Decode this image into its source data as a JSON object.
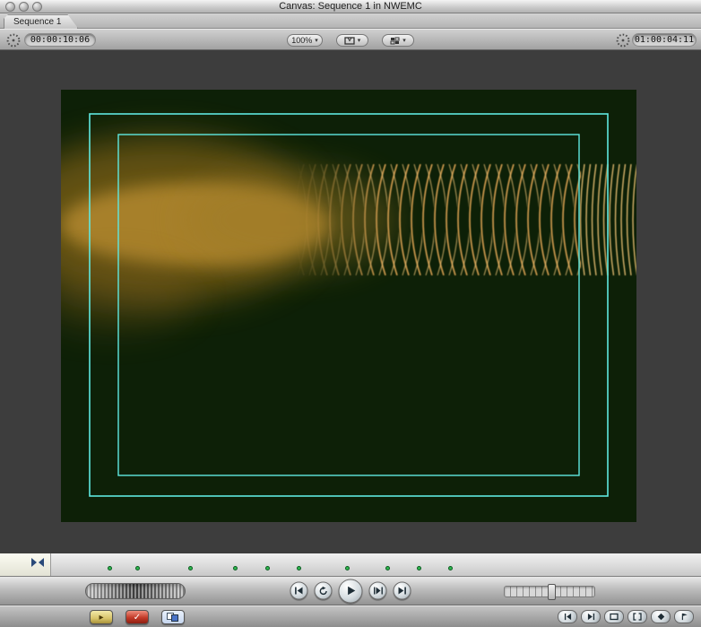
{
  "window": {
    "title": "Canvas: Sequence 1 in NWEMC"
  },
  "tabs": [
    {
      "label": "Sequence 1"
    }
  ],
  "toolbar": {
    "current_timecode": "00:00:10:06",
    "zoom_value": "100%",
    "timeline_timecode": "01:00:04:11",
    "caret_glyph": "▾",
    "icons": [
      "clock-icon",
      "view-popup-icon",
      "layout-popup-icon",
      "clock-icon"
    ]
  },
  "scrubber": {
    "playhead_position_pct": 4.7,
    "marker_positions_pct": [
      15.3,
      19.3,
      26.8,
      33.3,
      37.8,
      42.3,
      49.2,
      55.0,
      59.4,
      63.9
    ]
  },
  "transport": {
    "buttons": [
      {
        "name": "previous-edit"
      },
      {
        "name": "play-around"
      },
      {
        "name": "play"
      },
      {
        "name": "play-in-to-out"
      },
      {
        "name": "next-edit"
      }
    ]
  },
  "bottom_bar": {
    "left_buttons": [
      {
        "name": "clip-overlay",
        "glyph": "▸"
      },
      {
        "name": "render-check",
        "glyph": "✓"
      },
      {
        "name": "view-mode"
      }
    ],
    "right_buttons": [
      {
        "name": "previous-frame"
      },
      {
        "name": "next-frame"
      },
      {
        "name": "match-frame"
      },
      {
        "name": "mark-clip"
      },
      {
        "name": "add-keyframe"
      },
      {
        "name": "add-marker"
      }
    ]
  },
  "colors": {
    "canvas_background": "#3d3d3d",
    "frame_background": "#0d2007",
    "safe_guide_cyan": "#5fe8e0",
    "wave_gold": "#cf9a4e",
    "wave_gold_bright": "#e7bd71",
    "blur_orange": "#a9791f",
    "marker_green": "#2fb84e",
    "button_red": "#c23a28",
    "button_yellow": "#d8c46a",
    "button_blue": "#4a74c8"
  }
}
